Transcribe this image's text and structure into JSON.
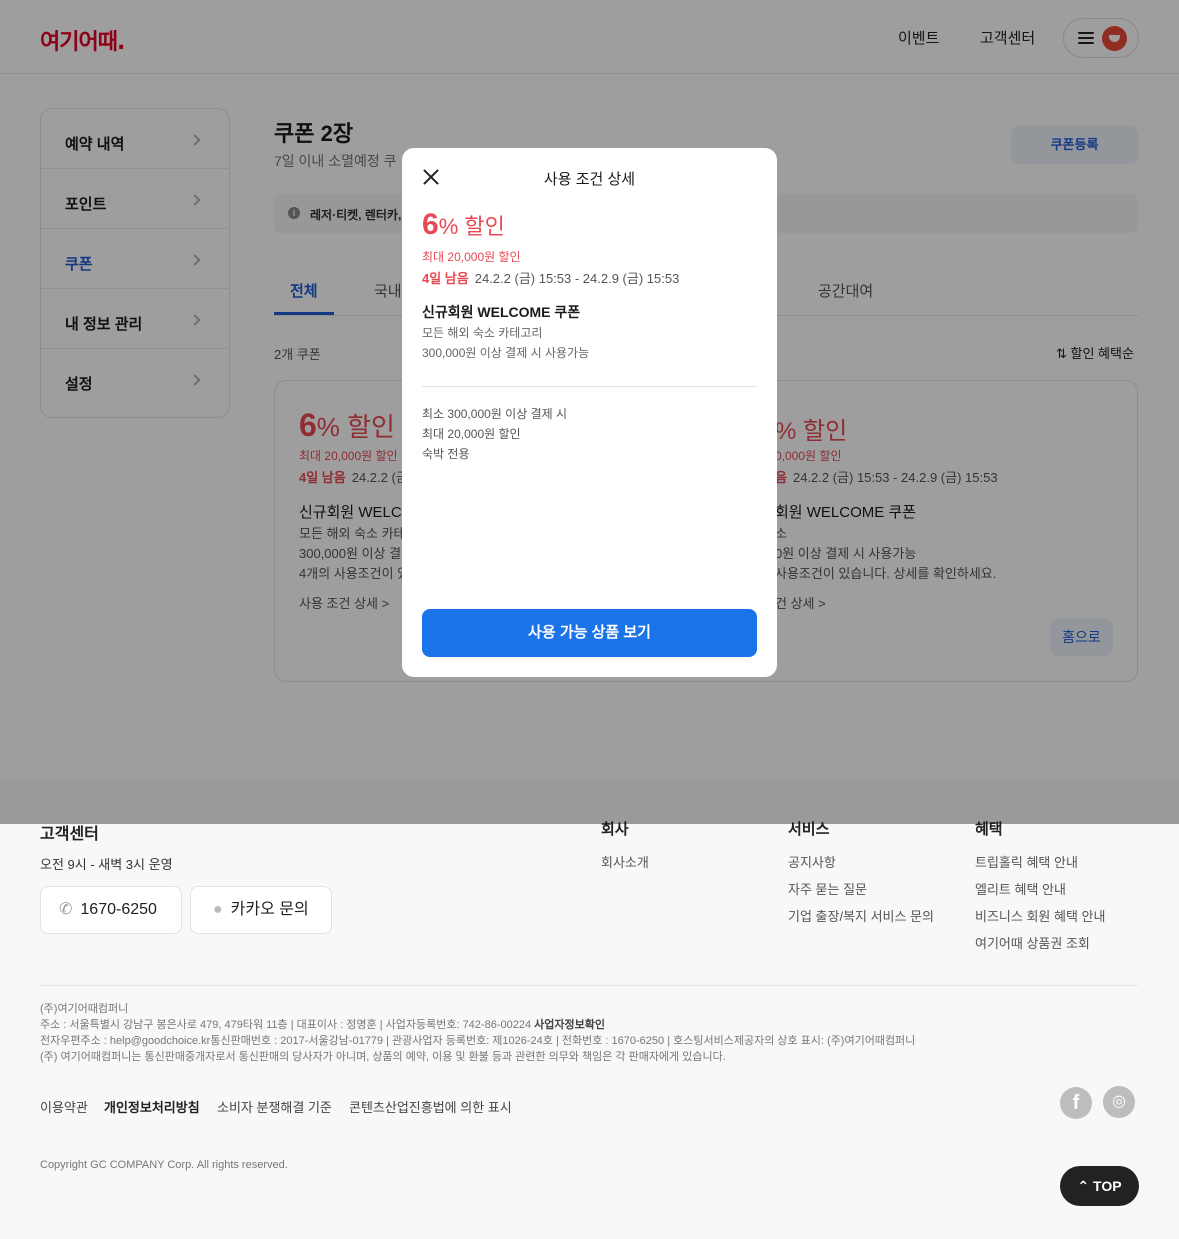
{
  "header": {
    "logo": "여기어때.",
    "nav": {
      "event": "이벤트",
      "customer_center": "고객센터"
    }
  },
  "sidebar": {
    "items": [
      {
        "label": "예약 내역"
      },
      {
        "label": "포인트"
      },
      {
        "label": "쿠폰"
      },
      {
        "label": "내 정보 관리"
      },
      {
        "label": "설정"
      }
    ]
  },
  "main": {
    "title": "쿠폰 2장",
    "subtitle": "7일 이내 소멸예정 쿠",
    "register_button": "쿠폰등록",
    "notice": "레저·티켓, 렌터카,",
    "tabs": [
      {
        "label": "전체"
      },
      {
        "label": "국내"
      },
      {
        "label": "공간대여"
      }
    ],
    "count": "2개 쿠폰",
    "sort": "할인 혜택순",
    "card_left": {
      "pct": "6",
      "pct_suffix": "% 할인",
      "max": "최대 20,000원 할인",
      "remain": "4일 남음",
      "period": "24.2.2 (금",
      "name": "신규회원 WELCO",
      "category": "모든 해외 숙소 카테고",
      "condition": "300,000원 이상 결",
      "extra": "4개의 사용조건이 있",
      "detail_link": "사용 조건 상세 >"
    },
    "card_right": {
      "pct": "% 할인",
      "max": "0,000원 할인",
      "remain": "음",
      "period": "24.2.2 (금) 15:53 - 24.2.9 (금) 15:53",
      "name": "회원 WELCOME 쿠폰",
      "category": "소",
      "condition": "0원 이상 결제 시 사용가능",
      "extra": "사용조건이 있습니다. 상세를 확인하세요.",
      "detail_link": "건 상세 >",
      "home_button": "홈으로"
    }
  },
  "modal": {
    "title": "사용 조건 상세",
    "pct": "6",
    "pct_suffix": "% 할인",
    "max": "최대 20,000원 할인",
    "remain": "4일 남음",
    "period": "24.2.2 (금) 15:53 - 24.2.9 (금) 15:53",
    "name": "신규회원 WELCOME 쿠폰",
    "category": "모든 해외 숙소 카테고리",
    "condition": "300,000원 이상 결제 시 사용가능",
    "details": [
      "최소 300,000원 이상 결제 시",
      "최대 20,000원 할인",
      "숙박 전용"
    ],
    "button": "사용 가능 상품 보기"
  },
  "footer": {
    "cs_title": "고객센터",
    "hours": "오전 9시 - 새벽 3시 운영",
    "phone": "1670-6250",
    "kakao": "카카오 문의",
    "company": {
      "title": "회사",
      "links": [
        "회사소개"
      ]
    },
    "service": {
      "title": "서비스",
      "links": [
        "공지사항",
        "자주 묻는 질문",
        "기업 출장/복지 서비스 문의"
      ]
    },
    "benefit": {
      "title": "혜택",
      "links": [
        "트립홀릭 혜택 안내",
        "엘리트 혜택 안내",
        "비즈니스 회원 혜택 안내",
        "여기어때 상품권 조회"
      ]
    },
    "legal": {
      "line1": "(주)여기어때컴퍼니",
      "line2": "주소 : 서울특별시 강남구 봉은사로 479, 479타워 11층 | 대표이사 : 정명훈 | 사업자등록번호: 742-86-00224",
      "line2_link": "사업자정보확인",
      "line3": "전자우편주소 : help@goodchoice.kr통신판매번호 : 2017-서울강남-01779 | 관광사업자 등록번호: 제1026-24호 | 전화번호 : 1670-6250 | 호스팅서비스제공자의 상호 표시: (주)여기어때컴퍼니",
      "line4": "(주) 여기어때컴퍼니는 통신판매중개자로서 통신판매의 당사자가 아니며, 상품의 예약, 이용 및 환불 등과 관련한 의무와 책임은 각 판매자에게 있습니다."
    },
    "bottom_links": [
      "이용약관",
      "개인정보처리방침",
      "소비자 분쟁해결 기준",
      "콘텐츠산업진흥법에 의한 표시"
    ],
    "copyright": "Copyright GC COMPANY Corp. All rights reserved.",
    "top_button": "TOP"
  }
}
